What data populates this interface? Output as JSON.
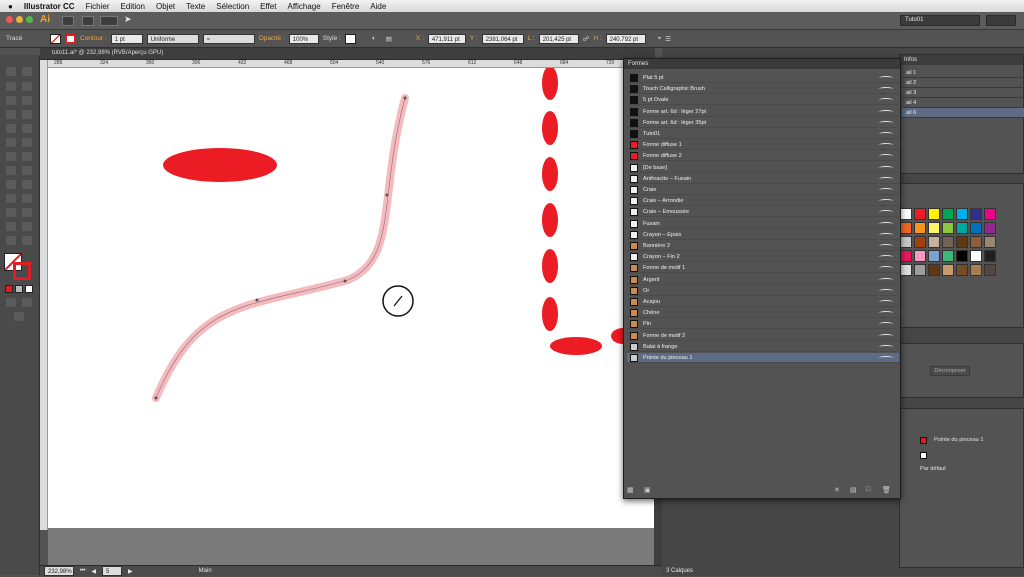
{
  "menubar": {
    "apple": "",
    "app": "Illustrator CC",
    "items": [
      "Fichier",
      "Edition",
      "Objet",
      "Texte",
      "Sélection",
      "Effet",
      "Affichage",
      "Fenêtre",
      "Aide"
    ]
  },
  "appbar": {
    "logo": "Ai",
    "workspace": "Tuto01"
  },
  "control": {
    "object_type": "Tracé",
    "contour_label": "Contour :",
    "contour_value": "1 pt",
    "stroke_profile": "Uniforme",
    "opacity_label": "Opacité :",
    "opacity_value": "100%",
    "style_label": "Style :",
    "x_label": "X :",
    "x_value": "471,911 pt",
    "y_label": "Y :",
    "y_value": "2381,064 pt",
    "w_label": "L :",
    "w_value": "201,425 pt",
    "h_label": "H :",
    "h_value": "240,792 pt"
  },
  "document": {
    "tab_title": "tuto11.ai* @ 232,98% (RVB/Aperçu GPU)",
    "ruler_ticks": [
      "288",
      "324",
      "360",
      "396",
      "432",
      "468",
      "504",
      "540",
      "576",
      "612",
      "648",
      "684",
      "720"
    ]
  },
  "status": {
    "zoom": "232,98%",
    "artboard": "5",
    "tool": "Main"
  },
  "brushes_panel": {
    "title": "Formes",
    "items": [
      {
        "name": "Plat 5 pt",
        "icon": "calligraphic"
      },
      {
        "name": "Touch Calligraphic Brush",
        "icon": "calligraphic"
      },
      {
        "name": "5 pt Ovale",
        "icon": "calligraphic"
      },
      {
        "name": "Forme art. 6d : léger 27pt",
        "icon": "calligraphic"
      },
      {
        "name": "Forme art. 6d : léger 35pt",
        "icon": "calligraphic"
      },
      {
        "name": "Tuto01",
        "icon": "calligraphic"
      },
      {
        "name": "Forme diffuse 1",
        "icon": "scatter"
      },
      {
        "name": "Forme diffuse 2",
        "icon": "scatter"
      },
      {
        "name": "[De base]",
        "icon": "art"
      },
      {
        "name": "Anthracite – Fusain",
        "icon": "art"
      },
      {
        "name": "Craie",
        "icon": "art"
      },
      {
        "name": "Craie – Arrondie",
        "icon": "art"
      },
      {
        "name": "Craie – Emoussée",
        "icon": "art"
      },
      {
        "name": "Fusain",
        "icon": "art"
      },
      {
        "name": "Crayon – Epais",
        "icon": "art"
      },
      {
        "name": "Bannière 2",
        "icon": "pattern"
      },
      {
        "name": "Crayon – Fin 2",
        "icon": "art"
      },
      {
        "name": "Forme de motif 1",
        "icon": "pattern"
      },
      {
        "name": "Argent",
        "icon": "pattern"
      },
      {
        "name": "Or",
        "icon": "pattern"
      },
      {
        "name": "Acajou",
        "icon": "pattern"
      },
      {
        "name": "Chêne",
        "icon": "pattern"
      },
      {
        "name": "Pin",
        "icon": "pattern"
      },
      {
        "name": "Forme de motif 2",
        "icon": "pattern"
      },
      {
        "name": "Balai à frange",
        "icon": "bristle"
      },
      {
        "name": "Pointe du pinceau 1",
        "icon": "bristle",
        "selected": true
      }
    ]
  },
  "layers_panel": {
    "tab": "Infos",
    "items": [
      "ail 1",
      "ail 2",
      "ail 3",
      "ail 4",
      "ail 6"
    ],
    "footer": "3 Calques"
  },
  "transparency_panel": {
    "button": "Décomposer",
    "rows": [
      "Pointe du pinceau 1",
      "Par défaut"
    ]
  },
  "colors": {
    "accent": "#ec1c24",
    "selection": "#5d6c84",
    "panel": "#535353"
  }
}
